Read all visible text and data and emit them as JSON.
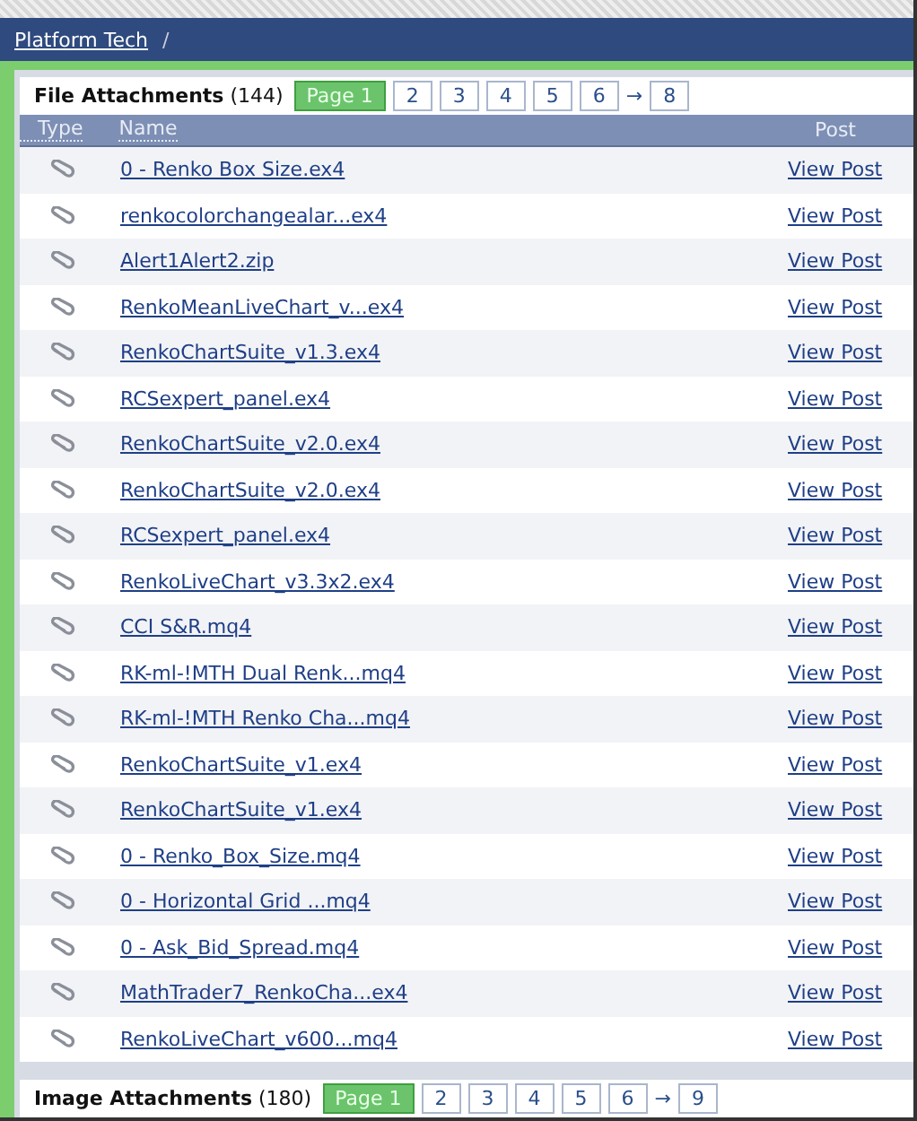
{
  "breadcrumb": {
    "links": [
      "Platform Tech"
    ],
    "separator": "/"
  },
  "file_attachments": {
    "title": "File Attachments",
    "count": "(144)",
    "pages": [
      {
        "label": "Page 1",
        "selected": true
      },
      {
        "label": "2",
        "selected": false
      },
      {
        "label": "3",
        "selected": false
      },
      {
        "label": "4",
        "selected": false
      },
      {
        "label": "5",
        "selected": false
      },
      {
        "label": "6",
        "selected": false
      },
      {
        "label": "→",
        "kind": "arrow",
        "selected": false
      },
      {
        "label": "8",
        "selected": false
      }
    ],
    "columns": [
      "Type",
      "Name",
      "Post"
    ],
    "rows": [
      {
        "name": "0 - Renko Box Size.ex4",
        "post": "View Post"
      },
      {
        "name": "renkocolorchangealar...ex4",
        "post": "View Post"
      },
      {
        "name": "Alert1Alert2.zip",
        "post": "View Post"
      },
      {
        "name": "RenkoMeanLiveChart_v...ex4",
        "post": "View Post"
      },
      {
        "name": "RenkoChartSuite_v1.3.ex4",
        "post": "View Post"
      },
      {
        "name": "RCSexpert_panel.ex4",
        "post": "View Post"
      },
      {
        "name": "RenkoChartSuite_v2.0.ex4",
        "post": "View Post"
      },
      {
        "name": "RenkoChartSuite_v2.0.ex4",
        "post": "View Post"
      },
      {
        "name": "RCSexpert_panel.ex4",
        "post": "View Post"
      },
      {
        "name": "RenkoLiveChart_v3.3x2.ex4",
        "post": "View Post"
      },
      {
        "name": "CCI S&R.mq4",
        "post": "View Post"
      },
      {
        "name": "RK-ml-!MTH Dual Renk...mq4",
        "post": "View Post"
      },
      {
        "name": "RK-ml-!MTH Renko Cha...mq4",
        "post": "View Post"
      },
      {
        "name": "RenkoChartSuite_v1.ex4",
        "post": "View Post"
      },
      {
        "name": "RenkoChartSuite_v1.ex4",
        "post": "View Post"
      },
      {
        "name": "0 - Renko_Box_Size.mq4",
        "post": "View Post"
      },
      {
        "name": "0 - Horizontal Grid ...mq4",
        "post": "View Post"
      },
      {
        "name": "0 - Ask_Bid_Spread.mq4",
        "post": "View Post"
      },
      {
        "name": "MathTrader7_RenkoCha...ex4",
        "post": "View Post"
      },
      {
        "name": "RenkoLiveChart_v600...mq4",
        "post": "View Post"
      }
    ]
  },
  "image_attachments": {
    "title": "Image Attachments",
    "count": "(180)",
    "pages": [
      {
        "label": "Page 1",
        "selected": true
      },
      {
        "label": "2",
        "selected": false
      },
      {
        "label": "3",
        "selected": false
      },
      {
        "label": "4",
        "selected": false
      },
      {
        "label": "5",
        "selected": false
      },
      {
        "label": "6",
        "selected": false
      },
      {
        "label": "→",
        "kind": "arrow",
        "selected": false
      },
      {
        "label": "9",
        "selected": false
      }
    ]
  }
}
